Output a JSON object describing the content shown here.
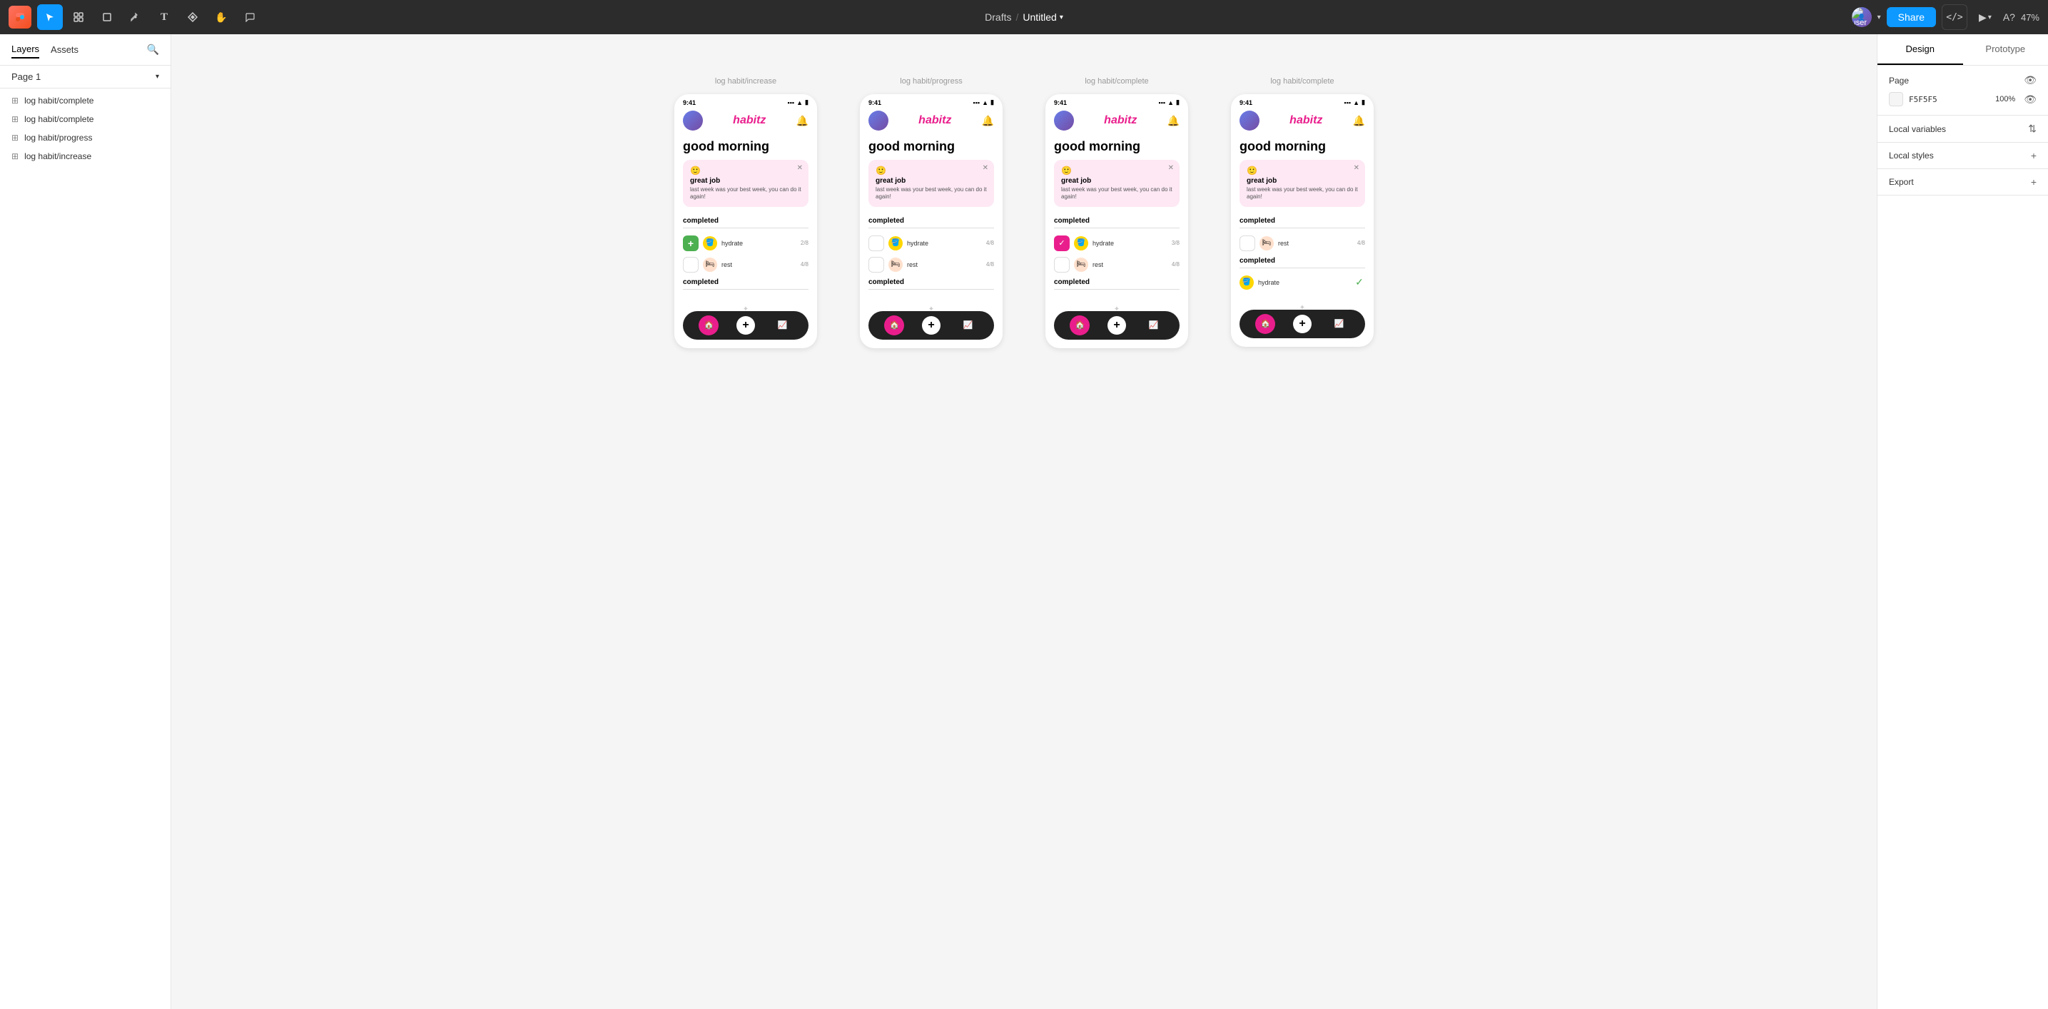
{
  "toolbar": {
    "figma_label": "F",
    "title": "Untitled",
    "drafts": "Drafts",
    "share_label": "Share",
    "zoom": "47%",
    "code_label": "</>",
    "tools": [
      {
        "name": "move",
        "icon": "↖",
        "active": true
      },
      {
        "name": "frame",
        "icon": "⊞",
        "active": false
      },
      {
        "name": "shape",
        "icon": "□",
        "active": false
      },
      {
        "name": "pen",
        "icon": "✒",
        "active": false
      },
      {
        "name": "text",
        "icon": "T",
        "active": false
      },
      {
        "name": "component",
        "icon": "⊕",
        "active": false
      },
      {
        "name": "hand",
        "icon": "✋",
        "active": false
      },
      {
        "name": "comment",
        "icon": "💬",
        "active": false
      }
    ]
  },
  "left_panel": {
    "tabs": [
      {
        "label": "Layers",
        "active": true
      },
      {
        "label": "Assets",
        "active": false
      }
    ],
    "page": "Page 1",
    "layers": [
      {
        "label": "log habit/complete",
        "icon": "⊞"
      },
      {
        "label": "log habit/complete",
        "icon": "⊞"
      },
      {
        "label": "log habit/progress",
        "icon": "⊞"
      },
      {
        "label": "log habit/increase",
        "icon": "⊞"
      }
    ]
  },
  "frames": [
    {
      "label": "log habit/increase",
      "time": "9:41",
      "greeting": "good morning",
      "notif_emoji": "🙂",
      "notif_title": "great job",
      "notif_body": "last week was your best week,\nyou can do it again!",
      "section1_title": "completed",
      "habits": [
        {
          "check_type": "green_add",
          "icon": "🪣",
          "icon_bg": "yellow",
          "name": "hydrate",
          "count": "2/8"
        },
        {
          "check_type": "empty",
          "icon": "🛏",
          "icon_bg": "orange",
          "name": "rest",
          "count": "4/8"
        }
      ],
      "section2_title": "completed",
      "nav_sparkle": "✦"
    },
    {
      "label": "log habit/progress",
      "time": "9:41",
      "greeting": "good morning",
      "notif_emoji": "🙂",
      "notif_title": "great job",
      "notif_body": "last week was your best week,\nyou can do it again!",
      "section1_title": "completed",
      "habits": [
        {
          "check_type": "empty",
          "icon": "🪣",
          "icon_bg": "yellow",
          "name": "hydrate",
          "count": "4/8"
        },
        {
          "check_type": "empty",
          "icon": "🛏",
          "icon_bg": "orange",
          "name": "rest",
          "count": "4/8"
        }
      ],
      "section2_title": "completed",
      "nav_sparkle": "✦"
    },
    {
      "label": "log habit/complete",
      "time": "9:41",
      "greeting": "good morning",
      "notif_emoji": "🙂",
      "notif_title": "great job",
      "notif_body": "last week was your best week,\nyou can do it again!",
      "section1_title": "completed",
      "habits": [
        {
          "check_type": "pink",
          "icon": "🪣",
          "icon_bg": "yellow",
          "name": "hydrate",
          "count": "3/8"
        },
        {
          "check_type": "empty",
          "icon": "🛏",
          "icon_bg": "orange",
          "name": "rest",
          "count": "4/8"
        }
      ],
      "section2_title": "completed",
      "nav_sparkle": "✦"
    },
    {
      "label": "log habit/complete",
      "time": "9:41",
      "greeting": "good morning",
      "notif_emoji": "🙂",
      "notif_title": "great job",
      "notif_body": "last week was your best week,\nyou can do it again!",
      "section1_title": "completed",
      "habits": [
        {
          "check_type": "empty",
          "icon": "🛏",
          "icon_bg": "orange",
          "name": "rest",
          "count": "4/8"
        }
      ],
      "section2_title": "completed",
      "completed_habits": [
        {
          "icon": "🪣",
          "icon_bg": "yellow",
          "name": "hydrate",
          "done": true
        }
      ],
      "nav_sparkle": "✦"
    }
  ],
  "right_panel": {
    "tabs": [
      {
        "label": "Design",
        "active": true
      },
      {
        "label": "Prototype",
        "active": false
      }
    ],
    "page_section": {
      "title": "Page",
      "color_hex": "F5F5F5",
      "opacity": "100%"
    },
    "local_variables": {
      "label": "Local variables",
      "icon": "⇅"
    },
    "local_styles": {
      "label": "Local styles",
      "add_icon": "+"
    },
    "export": {
      "label": "Export",
      "add_icon": "+"
    }
  }
}
